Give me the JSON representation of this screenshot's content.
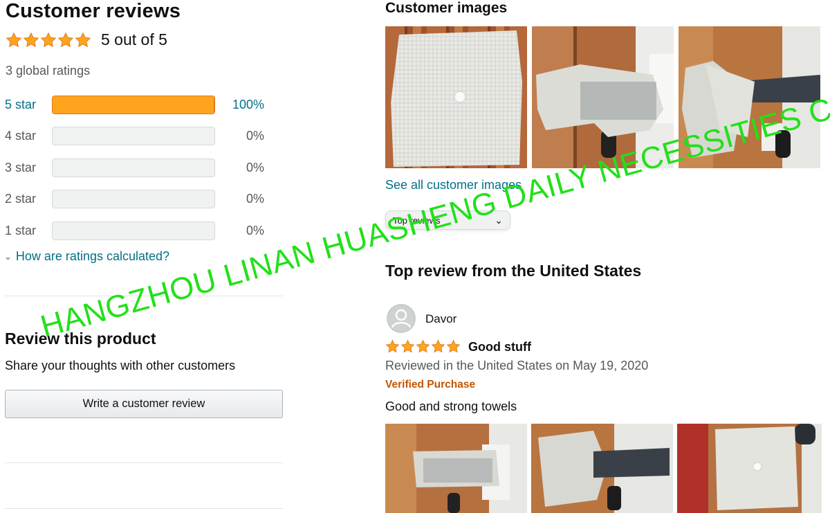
{
  "summary": {
    "title": "Customer reviews",
    "rating": 5,
    "rating_text": "5 out of 5",
    "global_ratings": "3 global ratings",
    "histogram": [
      {
        "label": "5 star",
        "percent_text": "100%",
        "fraction": 1.0
      },
      {
        "label": "4 star",
        "percent_text": "0%",
        "fraction": 0.0
      },
      {
        "label": "3 star",
        "percent_text": "0%",
        "fraction": 0.0
      },
      {
        "label": "2 star",
        "percent_text": "0%",
        "fraction": 0.0
      },
      {
        "label": "1 star",
        "percent_text": "0%",
        "fraction": 0.0
      }
    ],
    "how_calculated": "How are ratings calculated?"
  },
  "review_product": {
    "title": "Review this product",
    "subtitle": "Share your thoughts with other customers",
    "button": "Write a customer review"
  },
  "customer_images": {
    "title": "Customer images",
    "see_all": "See all customer images"
  },
  "sort": {
    "value": "Top reviews"
  },
  "top_review": {
    "heading": "Top review from the United States",
    "reviewer": "Davor",
    "rating": 5,
    "title": "Good stuff",
    "date": "Reviewed in the United States on May 19, 2020",
    "verified": "Verified Purchase",
    "body": "Good and strong towels"
  },
  "watermark": "HANGZHOU LINAN HUASHENG DAILY NECESSITIES CO.,LTD",
  "colors": {
    "star": "#ffa41c",
    "link": "#007185",
    "verified": "#c45500",
    "watermark": "#22e01a"
  }
}
